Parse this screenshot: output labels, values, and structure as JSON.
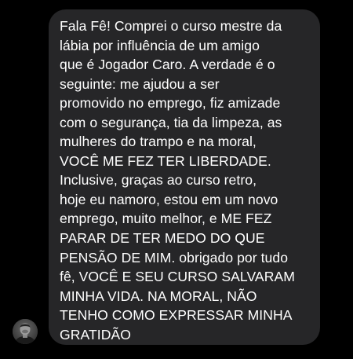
{
  "message": {
    "lines": [
      "Fala Fê! Comprei o curso mestre da",
      "lábia por influência de um amigo",
      "que é Jogador Caro. A verdade é o",
      "seguinte: me ajudou a ser",
      "promovido no emprego, fiz amizade",
      "com o segurança, tia da limpeza, as",
      "mulheres do trampo e na moral,",
      "VOCÊ ME FEZ TER LIBERDADE.",
      "Inclusive, graças ao curso retro,",
      "hoje eu namoro, estou em um novo",
      "emprego, muito melhor, e ME FEZ",
      "PARAR DE TER MEDO DO QUE",
      "PENSÃO DE MIM. obrigado por tudo",
      "fê, VOCÊ E SEU CURSO SALVARAM",
      "MINHA VIDA. NA MORAL, NÃO",
      "TENHO COMO EXPRESSAR MINHA",
      "GRATIDÃO"
    ]
  },
  "colors": {
    "background": "#000000",
    "bubble": "#262628",
    "text": "#ffffff"
  },
  "icons": {
    "avatar": "user-avatar-photo"
  }
}
